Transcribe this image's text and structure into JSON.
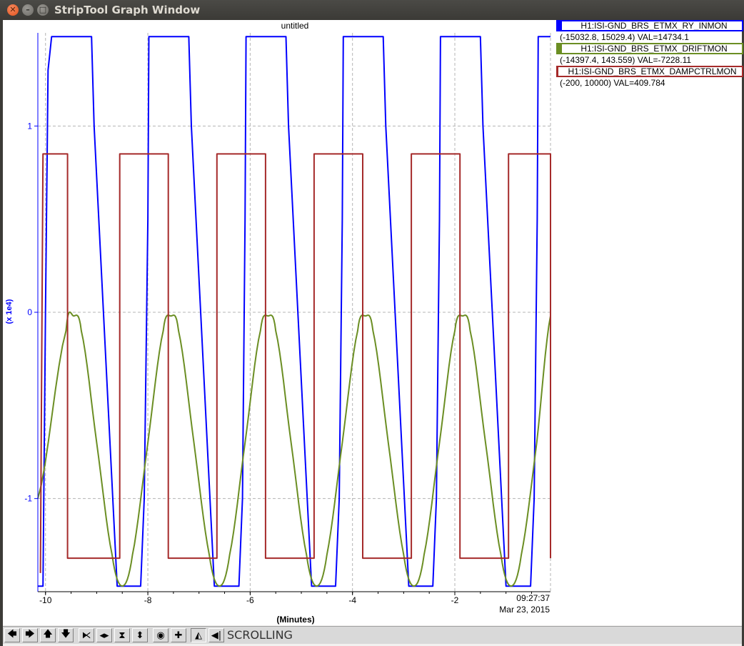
{
  "window": {
    "title": "StripTool Graph Window",
    "close_glyph": "✕",
    "min_glyph": "–",
    "max_glyph": "□"
  },
  "plot": {
    "title": "untitled",
    "y_multiplier": "(x 1e4)",
    "xlabel": "(Minutes)",
    "time": "09:27:37",
    "date": "Mar 23, 2015",
    "y_ticks": [
      {
        "value": 1,
        "label": "1"
      },
      {
        "value": 0,
        "label": "0"
      },
      {
        "value": -1,
        "label": "-1"
      }
    ],
    "x_ticks": [
      {
        "value": -10,
        "label": "-10"
      },
      {
        "value": -8,
        "label": "-8"
      },
      {
        "value": -6,
        "label": "-6"
      },
      {
        "value": -4,
        "label": "-4"
      },
      {
        "value": -2,
        "label": "-2"
      }
    ],
    "colors": {
      "axis_y": "#0000ff",
      "grid": "#b4b4b4"
    }
  },
  "legend": [
    {
      "name": "H1:ISI-GND_BRS_ETMX_RY_INMON",
      "range": "(-15032.8, 15029.4) VAL=14734.1",
      "color": "#0000ff"
    },
    {
      "name": "H1:ISI-GND_BRS_ETMX_DRIFTMON",
      "range": "(-14397.4, 143.559) VAL=-7228.11",
      "color": "#6b8e23"
    },
    {
      "name": "H1:ISI-GND_BRS_ETMX_DAMPCTRLMON",
      "range": "(-200, 10000) VAL=409.784",
      "color": "#a52a2a"
    }
  ],
  "toolbar": {
    "status": "SCROLLING",
    "buttons": [
      {
        "name": "left-arrow-icon",
        "glyph": "🡄"
      },
      {
        "name": "right-arrow-icon",
        "glyph": "🡆"
      },
      {
        "name": "up-arrow-icon",
        "glyph": "🡅"
      },
      {
        "name": "down-arrow-icon",
        "glyph": "🡇"
      },
      {
        "name": "zoom-in-horizontal-icon",
        "glyph": "⧔"
      },
      {
        "name": "zoom-out-horizontal-icon",
        "glyph": "◂▸"
      },
      {
        "name": "zoom-in-vertical-icon",
        "glyph": "⧗"
      },
      {
        "name": "zoom-out-vertical-icon",
        "glyph": "⬍"
      },
      {
        "name": "reset-icon",
        "glyph": "◉"
      },
      {
        "name": "add-icon",
        "glyph": "✚"
      },
      {
        "name": "auto-scale-icon",
        "glyph": "◭"
      },
      {
        "name": "scroll-mode-icon",
        "glyph": "◀|"
      }
    ]
  },
  "chart_data": {
    "type": "line",
    "title": "untitled",
    "xlabel": "(Minutes)",
    "ylabel": "(x 1e4)",
    "xlim": [
      -10.15,
      -0.13
    ],
    "ylim": [
      -1.5,
      1.5
    ],
    "grid": true,
    "legend_position": "right",
    "series": [
      {
        "name": "H1:ISI-GND_BRS_ETMX_RY_INMON",
        "color": "#0000ff",
        "kind": "step",
        "x": [
          -10.15,
          -10.05,
          -10.0,
          -9.95,
          -9.88,
          -9.1,
          -9.05,
          -8.6,
          -8.55,
          -8.14,
          -8.07,
          -8.0,
          -7.98,
          -7.2,
          -7.15,
          -6.7,
          -6.65,
          -6.22,
          -6.15,
          -6.1,
          -6.08,
          -5.3,
          -5.25,
          -4.8,
          -4.75,
          -4.33,
          -4.26,
          -4.2,
          -4.18,
          -3.4,
          -3.35,
          -2.9,
          -2.85,
          -2.43,
          -2.36,
          -2.3,
          -2.28,
          -1.5,
          -1.45,
          -1.0,
          -0.95,
          -0.52,
          -0.45,
          -0.39,
          -0.37,
          -0.13
        ],
        "y": [
          -1.47,
          -1.47,
          0.0,
          1.3,
          1.48,
          1.48,
          1.0,
          -1.47,
          -1.47,
          -1.47,
          -1.0,
          0.5,
          1.48,
          1.48,
          1.0,
          -1.47,
          -1.47,
          -1.47,
          -1.0,
          0.5,
          1.48,
          1.48,
          1.0,
          -1.47,
          -1.47,
          -1.47,
          -1.0,
          0.5,
          1.48,
          1.48,
          1.0,
          -1.47,
          -1.47,
          -1.47,
          -1.0,
          0.5,
          1.48,
          1.48,
          1.0,
          -1.47,
          -1.47,
          -1.47,
          -1.0,
          0.5,
          1.48,
          1.48
        ]
      },
      {
        "name": "H1:ISI-GND_BRS_ETMX_DRIFTMON",
        "color": "#6b8e23",
        "kind": "sine",
        "x": [
          -10.15,
          -9.6,
          -9.45,
          -9.3,
          -9.0,
          -8.7,
          -8.5,
          -8.3,
          -8.0,
          -7.7,
          -7.55,
          -7.4,
          -7.1,
          -6.8,
          -6.6,
          -6.4,
          -6.1,
          -5.8,
          -5.65,
          -5.5,
          -5.2,
          -4.9,
          -4.7,
          -4.5,
          -4.2,
          -3.9,
          -3.75,
          -3.6,
          -3.3,
          -3.0,
          -2.8,
          -2.6,
          -2.3,
          -2.0,
          -1.85,
          -1.7,
          -1.4,
          -1.1,
          -0.9,
          -0.7,
          -0.4,
          -0.13
        ],
        "y": [
          -1.0,
          -0.1,
          -0.02,
          -0.1,
          -0.7,
          -1.3,
          -1.47,
          -1.3,
          -0.7,
          -0.1,
          -0.02,
          -0.1,
          -0.7,
          -1.3,
          -1.47,
          -1.3,
          -0.7,
          -0.1,
          -0.02,
          -0.1,
          -0.7,
          -1.3,
          -1.47,
          -1.3,
          -0.7,
          -0.1,
          -0.02,
          -0.1,
          -0.7,
          -1.3,
          -1.47,
          -1.3,
          -0.7,
          -0.1,
          -0.02,
          -0.1,
          -0.7,
          -1.3,
          -1.47,
          -1.3,
          -0.7,
          -0.02
        ]
      },
      {
        "name": "H1:ISI-GND_BRS_ETMX_DAMPCTRLMON",
        "color": "#a52a2a",
        "kind": "step",
        "x": [
          -10.1,
          -10.05,
          -9.57,
          -9.57,
          -8.55,
          -8.55,
          -7.6,
          -7.6,
          -6.65,
          -6.65,
          -5.7,
          -5.7,
          -4.75,
          -4.75,
          -3.8,
          -3.8,
          -2.85,
          -2.85,
          -1.9,
          -1.9,
          -0.95,
          -0.95,
          -0.13,
          -0.13
        ],
        "y": [
          -1.4,
          0.85,
          0.85,
          -1.32,
          -1.32,
          0.85,
          0.85,
          -1.32,
          -1.32,
          0.85,
          0.85,
          -1.32,
          -1.32,
          0.85,
          0.85,
          -1.32,
          -1.32,
          0.85,
          0.85,
          -1.32,
          -1.32,
          0.85,
          0.85,
          -1.32
        ]
      }
    ]
  }
}
